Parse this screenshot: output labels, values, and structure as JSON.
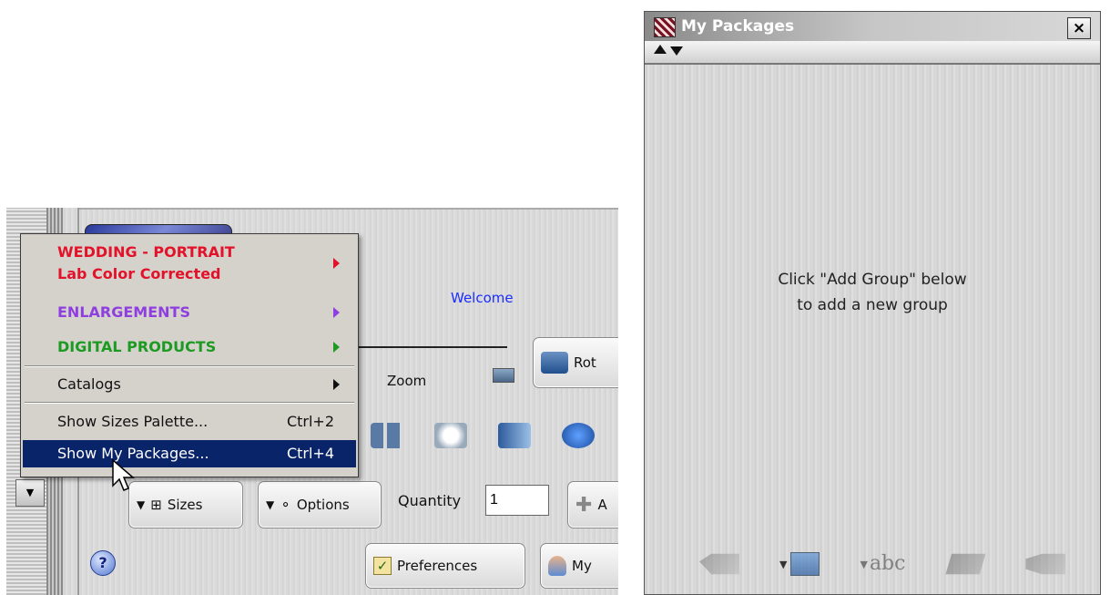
{
  "app": {
    "welcome": "Welcome",
    "zoom_label": "Zoom",
    "rotate_label": "Rot",
    "sizes_label": "Sizes",
    "options_label": "Options",
    "quantity_label": "Quantity",
    "quantity_value": "1",
    "add_label": "A",
    "preferences_label": "Preferences",
    "my_label": "My",
    "help_glyph": "?"
  },
  "menu": {
    "items": [
      {
        "label_line1": "WEDDING - PORTRAIT",
        "label_line2": "Lab Color Corrected",
        "color": "#e2122a"
      },
      {
        "label": "ENLARGEMENTS",
        "color": "#8f3fe0"
      },
      {
        "label": "DIGITAL PRODUCTS",
        "color": "#1d9a22"
      },
      {
        "label": "Catalogs"
      },
      {
        "label": "Show Sizes Palette...",
        "shortcut": "Ctrl+2"
      },
      {
        "label": "Show My Packages...",
        "shortcut": "Ctrl+4",
        "highlighted": true
      }
    ]
  },
  "packages_window": {
    "title": "My Packages",
    "close_glyph": "×",
    "hint_line1": "Click \"Add Group\" below",
    "hint_line2": "to add a new group",
    "text_tool_glyph": "abc"
  },
  "icons": [
    "help-icon",
    "rotate-icon",
    "sizes-icon",
    "options-icon",
    "add-icon",
    "checkbox-icon",
    "person-icon",
    "close-icon",
    "expand-icon",
    "collapse-icon"
  ]
}
